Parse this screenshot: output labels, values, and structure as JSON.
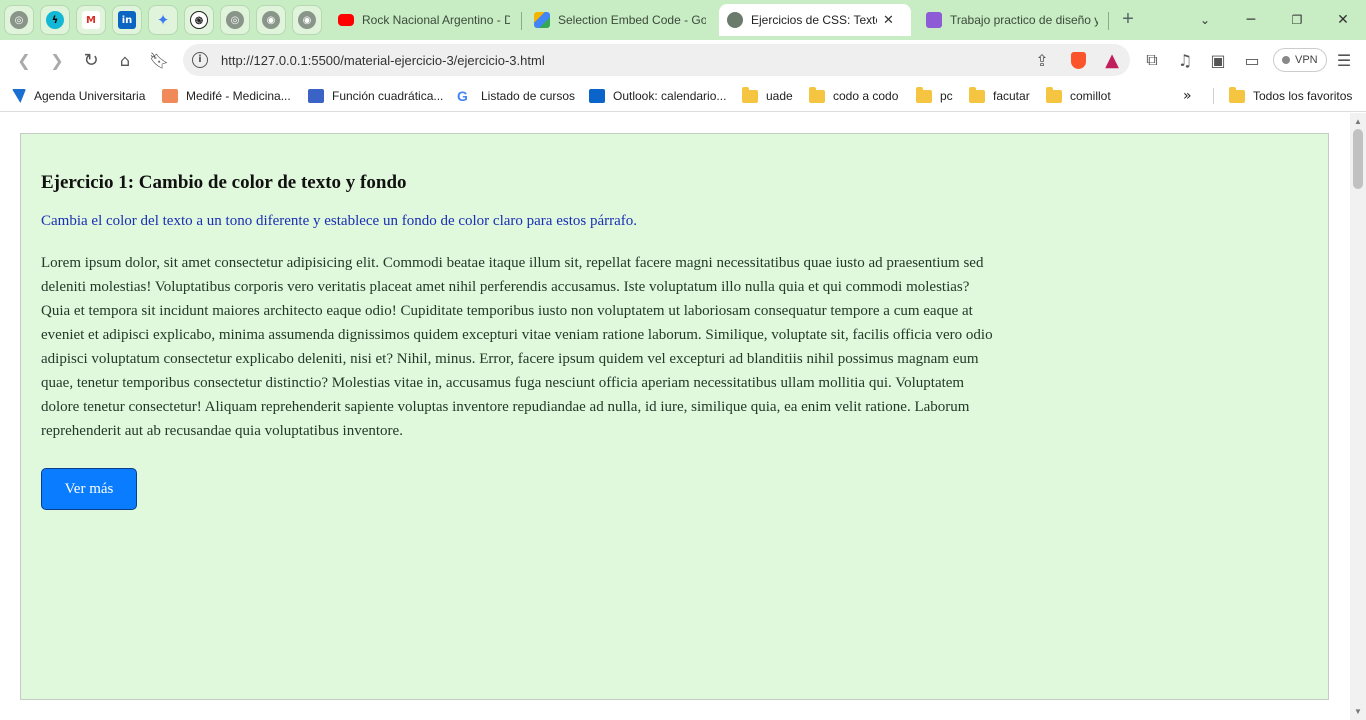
{
  "tabs": [
    {
      "title": "Rock Nacional Argentino - D",
      "icon": "youtube-icon",
      "color": "#ff0000"
    },
    {
      "title": "Selection Embed Code - Goo",
      "icon": "embed-icon",
      "color": "#4a8f3c"
    },
    {
      "title": "Ejercicios de CSS: Texto y",
      "icon": "globe-icon",
      "color": "#6b7b6b",
      "active": true
    },
    {
      "title": "Trabajo practico de diseño y",
      "icon": "badge-icon",
      "color": "#8e5bd6"
    }
  ],
  "pinned_tabs": [
    "globe-icon",
    "bolt-icon",
    "gmail-icon",
    "linkedin-icon",
    "gemini-icon",
    "chatgpt-icon",
    "globe-icon",
    "github-icon",
    "github-icon"
  ],
  "address_bar": {
    "url": "http://127.0.0.1:5500/material-ejercicio-3/ejercicio-3.html"
  },
  "vpn_label": "VPN",
  "bookmarks": [
    {
      "label": "Agenda Universitaria",
      "icon": "uade-icon"
    },
    {
      "label": "Medifé - Medicina...",
      "icon": "medife-icon"
    },
    {
      "label": "Función cuadrática...",
      "icon": "math-icon"
    },
    {
      "label": "Listado de cursos",
      "icon": "google-icon"
    },
    {
      "label": "Outlook: calendario...",
      "icon": "outlook-icon"
    },
    {
      "label": "uade",
      "icon": "folder-icon"
    },
    {
      "label": "codo a codo",
      "icon": "folder-icon"
    },
    {
      "label": "pc",
      "icon": "folder-icon"
    },
    {
      "label": "facutar",
      "icon": "folder-icon"
    },
    {
      "label": "comillot",
      "icon": "folder-icon"
    }
  ],
  "bookmarks_all": "Todos los favoritos",
  "page": {
    "heading": "Ejercicio 1: Cambio de color de texto y fondo",
    "lead": "Cambia el color del texto a un tono diferente y establece un fondo de color claro para estos párrafo.",
    "body": "Lorem ipsum dolor, sit amet consectetur adipisicing elit. Commodi beatae itaque illum sit, repellat facere magni necessitatibus quae iusto ad praesentium sed deleniti molestias! Voluptatibus corporis vero veritatis placeat amet nihil perferendis accusamus. Iste voluptatum illo nulla quia et qui commodi molestias? Quia et tempora sit incidunt maiores architecto eaque odio! Cupiditate temporibus iusto non voluptatem ut laboriosam consequatur tempore a cum eaque at eveniet et adipisci explicabo, minima assumenda dignissimos quidem excepturi vitae veniam ratione laborum. Similique, voluptate sit, facilis officia vero odio adipisci voluptatum consectetur explicabo deleniti, nisi et? Nihil, minus. Error, facere ipsum quidem vel excepturi ad blanditiis nihil possimus magnam eum quae, tenetur temporibus consectetur distinctio? Molestias vitae in, accusamus fuga nesciunt officia aperiam necessitatibus ullam mollitia qui. Voluptatem dolore tenetur consectetur! Aliquam reprehenderit sapiente voluptas inventore repudiandae ad nulla, id iure, similique quia, ea enim velit ratione. Laborum reprehenderit aut ab recusandae quia voluptatibus inventore.",
    "button": "Ver más"
  },
  "colors": {
    "tabbar": "#c8ecc3",
    "card_bg": "#e0f8dc",
    "lead_text": "#1a2fb5",
    "button_bg": "#0a7cff"
  }
}
